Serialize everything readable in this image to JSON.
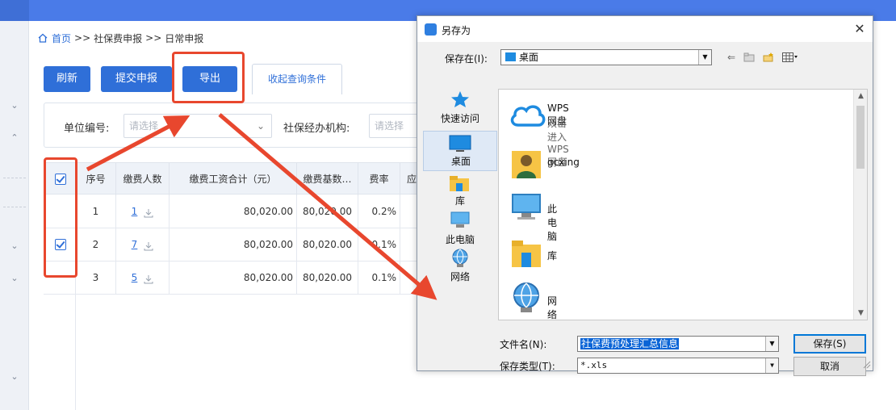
{
  "breadcrumb": {
    "home": "首页",
    "sep1": ">>",
    "item1": "社保费申报",
    "sep2": ">>",
    "item2": "日常申报"
  },
  "toolbar": {
    "refresh": "刷新",
    "submit": "提交申报",
    "export": "导出",
    "collapse": "收起查询条件"
  },
  "filters": {
    "unit_label": "单位编号:",
    "unit_placeholder": "请选择",
    "agency_label": "社保经办机构:",
    "agency_placeholder": "请选择"
  },
  "table": {
    "headers": [
      "序号",
      "缴费人数",
      "缴费工资合计（元）",
      "缴费基数…",
      "费率",
      "应"
    ],
    "rows": [
      {
        "checked": false,
        "index": "1",
        "count": "1",
        "wage_total": "80,020.00",
        "base": "80,020.00",
        "rate": "0.2%"
      },
      {
        "checked": true,
        "index": "2",
        "count": "7",
        "wage_total": "80,020.00",
        "base": "80,020.00",
        "rate": "0.1%"
      },
      {
        "checked": false,
        "index": "3",
        "count": "5",
        "wage_total": "80,020.00",
        "base": "80,020.00",
        "rate": "0.1%"
      }
    ]
  },
  "dialog": {
    "title": "另存为",
    "save_in_label": "保存在(I):",
    "save_in_value": "桌面",
    "places": [
      "快速访问",
      "桌面",
      "库",
      "此电脑",
      "网络"
    ],
    "files": [
      {
        "name": "WPS网盘",
        "sub": "双击进入WPS网盘"
      },
      {
        "name": "gcxing"
      },
      {
        "name": "此电脑"
      },
      {
        "name": "库"
      },
      {
        "name": "网络"
      }
    ],
    "filename_label": "文件名(N):",
    "filename_value": "社保费预处理汇总信息",
    "filetype_label": "保存类型(T):",
    "filetype_value": "*.xls",
    "save_button": "保存(S)",
    "cancel_button": "取消"
  },
  "colors": {
    "accent": "#2f6fd8",
    "highlight": "#e8472e",
    "topbar": "#4a7be8"
  }
}
